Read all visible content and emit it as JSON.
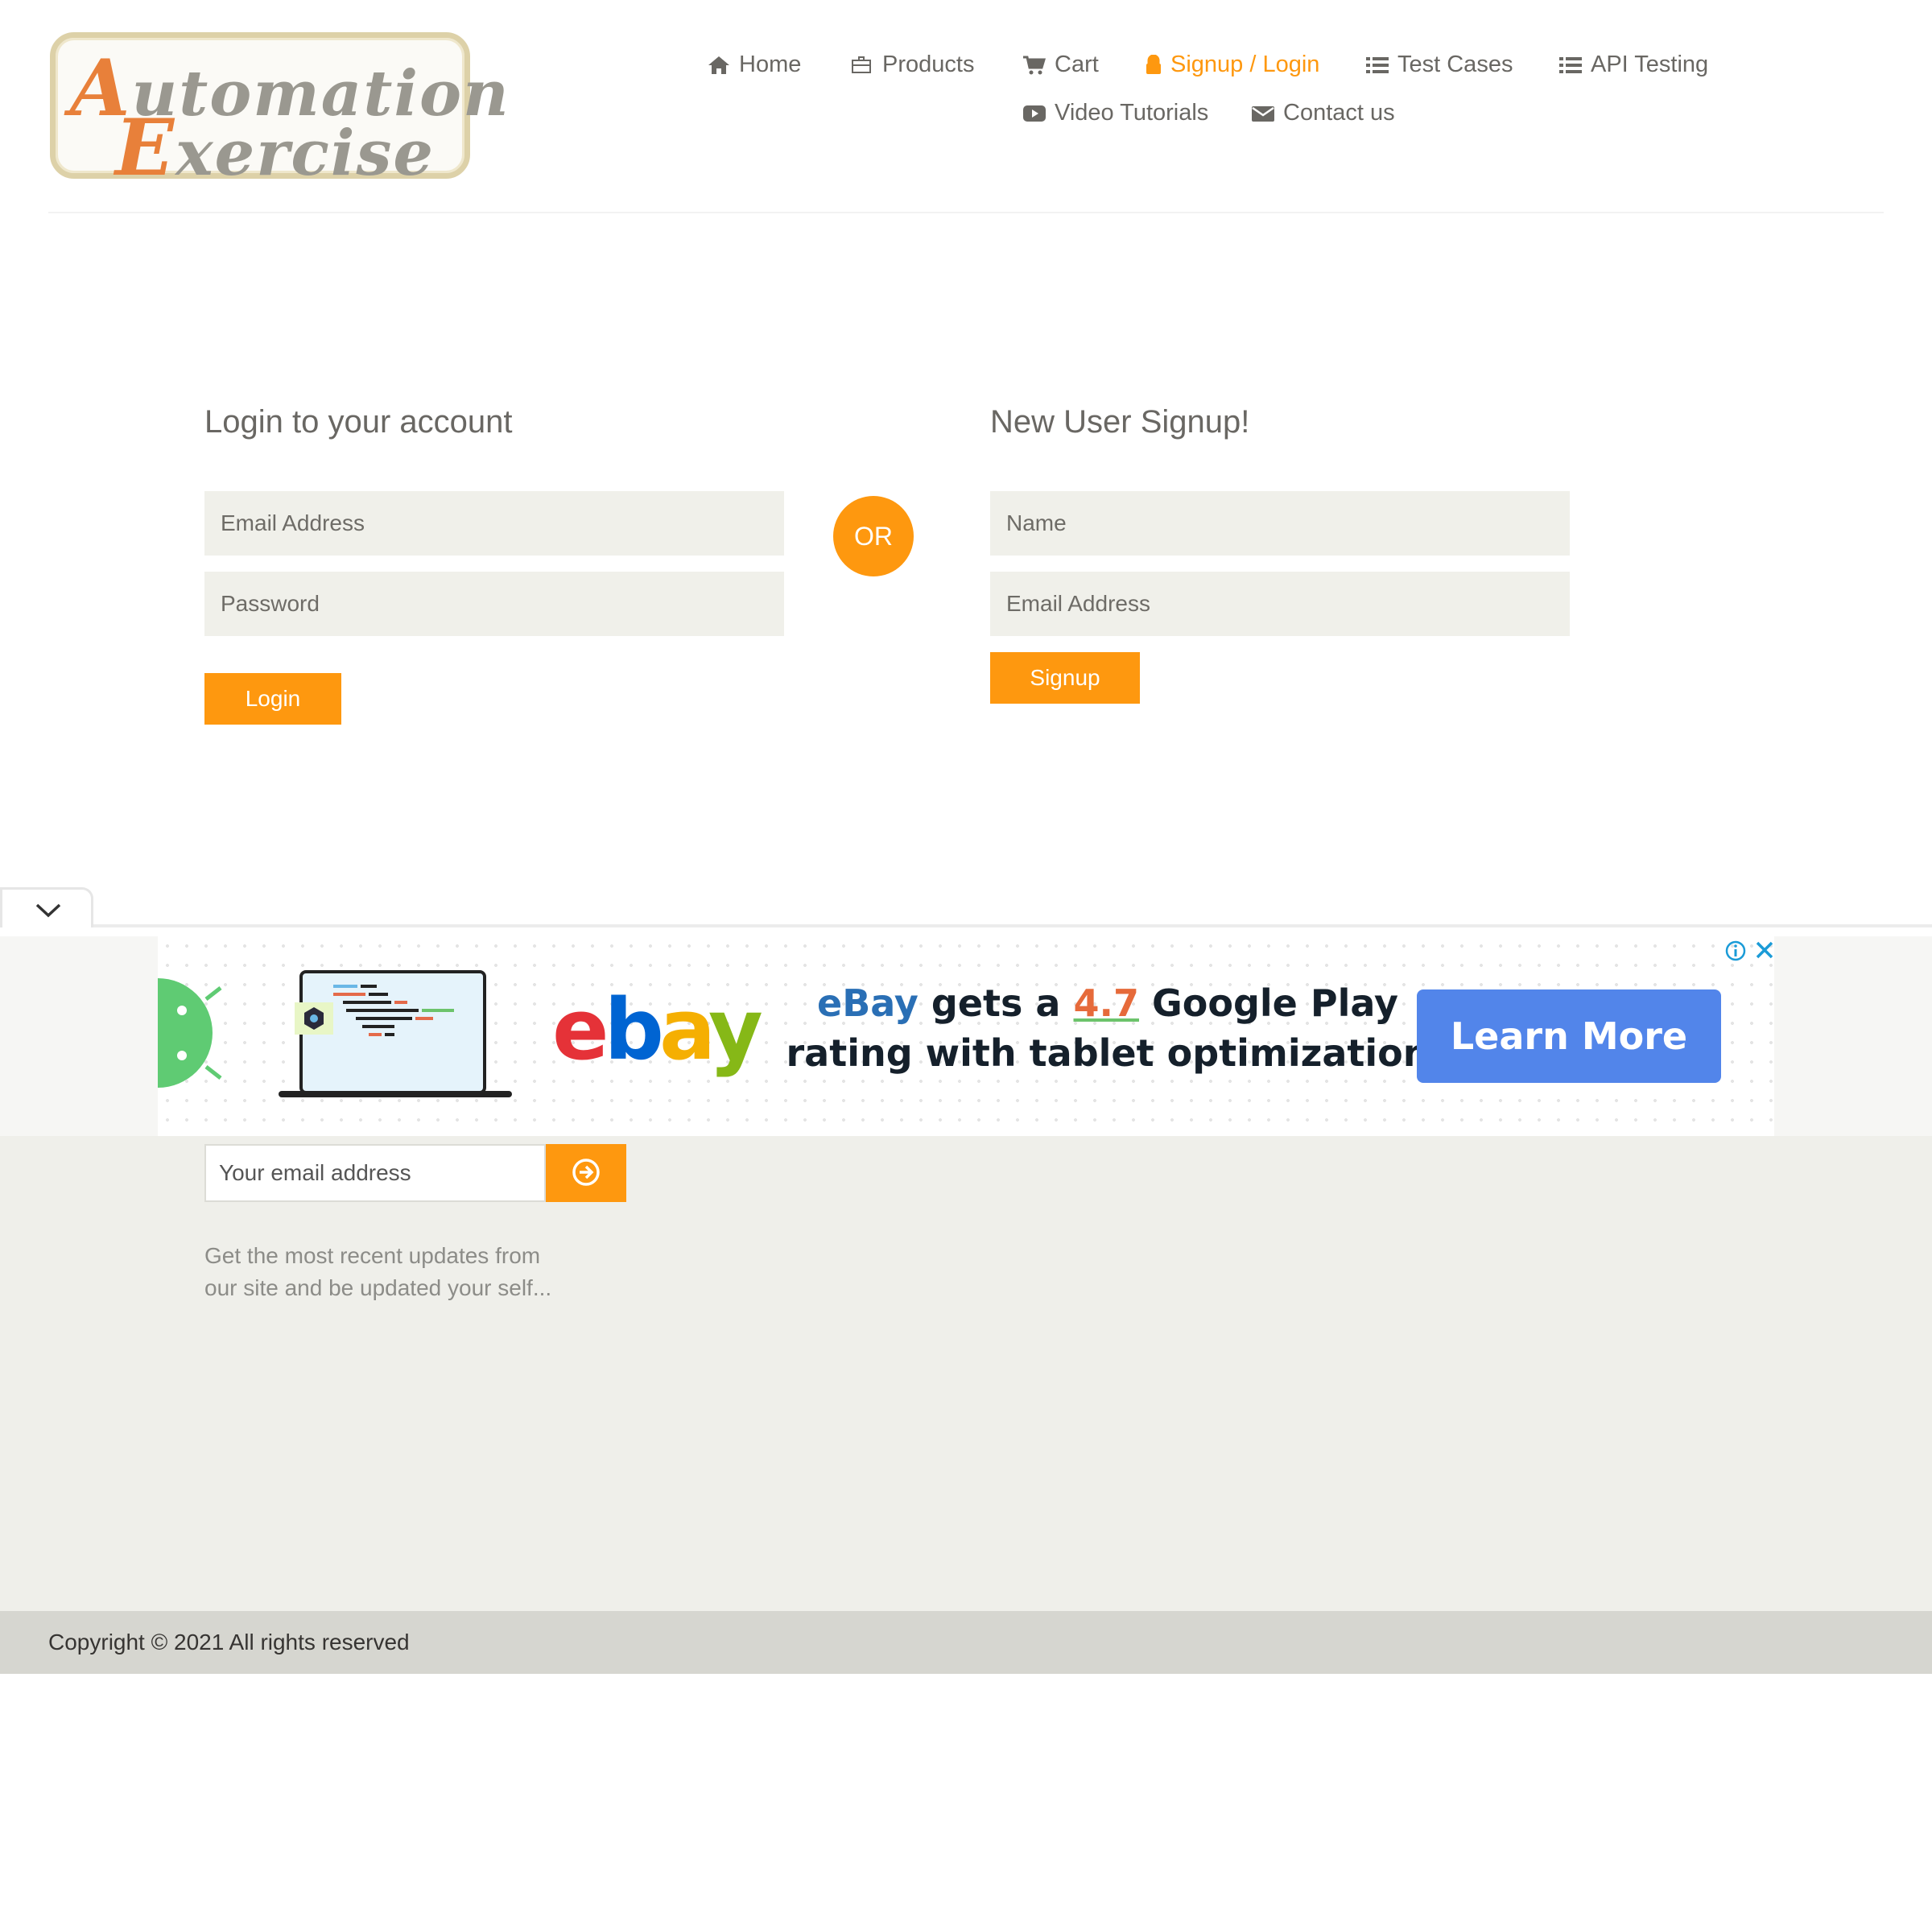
{
  "logo": {
    "line1": "Automation",
    "line2": "Exercise"
  },
  "nav": {
    "home": "Home",
    "products": "Products",
    "cart": "Cart",
    "signup_login": "Signup / Login",
    "test_cases": "Test Cases",
    "api_testing": "API Testing",
    "video_tutorials": "Video Tutorials",
    "contact_us": "Contact us",
    "active": "Signup / Login"
  },
  "login": {
    "title": "Login to your account",
    "email_placeholder": "Email Address",
    "password_placeholder": "Password",
    "button": "Login"
  },
  "divider": "OR",
  "signup": {
    "title": "New User Signup!",
    "name_placeholder": "Name",
    "email_placeholder": "Email Address",
    "button": "Signup"
  },
  "ad": {
    "brand": "ebay",
    "headline_prefix": "eBay",
    "headline_mid": " gets a ",
    "rating": "4.7",
    "headline_suffix": " Google Play",
    "headline_line2": "rating with tablet optimization",
    "cta": "Learn More"
  },
  "footer": {
    "subscribe_placeholder": "Your email address",
    "subscribe_desc": "Get the most recent updates from our site and be updated your self...",
    "copyright": "Copyright © 2021 All rights reserved"
  },
  "colors": {
    "accent": "#fe980f",
    "text": "#696763",
    "field_bg": "#f0f0ea",
    "footer_bg": "#efefea",
    "footer_bottom_bg": "#d6d6d0",
    "ad_cta": "#5285ea"
  },
  "icons": [
    "home-icon",
    "briefcase-icon",
    "cart-icon",
    "lock-icon",
    "list-icon",
    "video-icon",
    "envelope-icon",
    "chevron-down-icon",
    "info-icon",
    "close-icon",
    "arrow-circle-right-icon"
  ]
}
